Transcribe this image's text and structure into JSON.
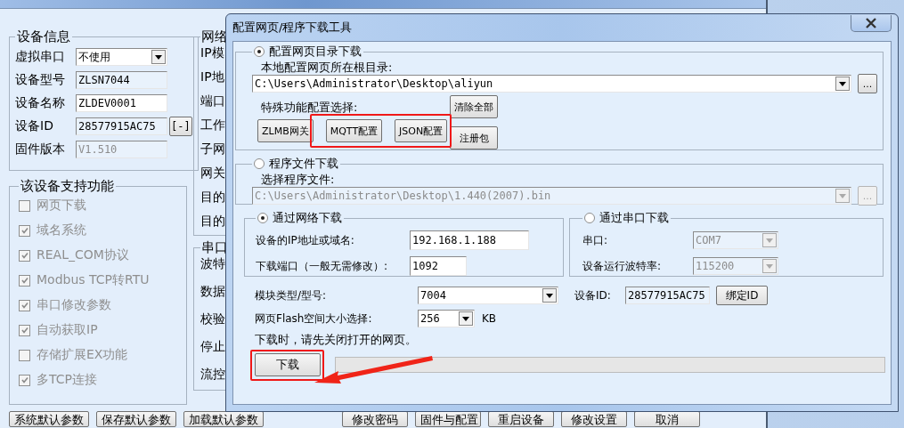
{
  "main_window": {
    "device_info": {
      "title": "设备信息",
      "fields": [
        {
          "kind": "select",
          "label": "虚拟串口",
          "value": "不使用"
        },
        {
          "kind": "readonly",
          "label": "设备型号",
          "value": "ZLSN7044"
        },
        {
          "kind": "text",
          "label": "设备名称",
          "value": "ZLDEV0001"
        },
        {
          "kind": "readonly_button",
          "label": "设备ID",
          "value": "28577915AC75",
          "button": "[-]"
        },
        {
          "kind": "disabled",
          "label": "固件版本",
          "value": "V1.510"
        }
      ]
    },
    "features": {
      "title": "该设备支持功能",
      "disabled": true,
      "items": [
        {
          "label": "网页下载",
          "checked": false
        },
        {
          "label": "域名系统",
          "checked": true
        },
        {
          "label": "REAL_COM协议",
          "checked": true
        },
        {
          "label": "Modbus TCP转RTU",
          "checked": true
        },
        {
          "label": "串口修改参数",
          "checked": true
        },
        {
          "label": "自动获取IP",
          "checked": true
        },
        {
          "label": "存储扩展EX功能",
          "checked": false
        },
        {
          "label": "多TCP连接",
          "checked": true
        }
      ]
    },
    "network": {
      "title": "网络",
      "labels": [
        "IP模",
        "IP地",
        "端口",
        "工作",
        "子网",
        "网关",
        "目的",
        "目的"
      ]
    },
    "serial": {
      "title": "串口",
      "labels": [
        "波特",
        "数据",
        "校验",
        "停止",
        "流控"
      ]
    },
    "buttons": [
      "系统默认参数",
      "保存默认参数",
      "加载默认参数",
      "修改密码",
      "固件与配置",
      "重启设备",
      "修改设置",
      "取消"
    ]
  },
  "dialog": {
    "title": "配置网页/程序下载工具",
    "web_dir": {
      "label": "配置网页目录下载",
      "selected": true,
      "path_label": "本地配置网页所在根目录:",
      "path": "C:\\Users\\Administrator\\Desktop\\aliyun",
      "browse": "...",
      "special_label": "特殊功能配置选择:",
      "clear_button": "清除全部",
      "buttons": [
        "ZLMB网关",
        "MQTT配置",
        "JSON配置",
        "注册包"
      ]
    },
    "program_file": {
      "label": "程序文件下载",
      "selected": false,
      "file_label": "选择程序文件:",
      "path": "C:\\Users\\Administrator\\Desktop\\1.440(2007).bin",
      "browse": "..."
    },
    "network": {
      "label": "通过网络下载",
      "selected": true,
      "ip_label": "设备的IP地址或域名:",
      "ip": "192.168.1.188",
      "port_label": "下载端口（一般无需修改）:",
      "port": "1092"
    },
    "serial": {
      "label": "通过串口下载",
      "selected": false,
      "port_label": "串口:",
      "port": "COM7",
      "baud_label": "设备运行波特率:",
      "baud": "115200"
    },
    "module_label": "模块类型/型号:",
    "module": "7004",
    "device_id_label": "设备ID:",
    "device_id": "28577915AC75",
    "bind_button": "绑定ID",
    "flash_label": "网页Flash空间大小选择:",
    "flash": "256",
    "flash_unit": "KB",
    "note": "下载时，请先关闭打开的网页。",
    "download_button": "下载",
    "progress": {
      "level": 0
    }
  },
  "annotations": [
    {
      "kind": "box"
    },
    {
      "kind": "box"
    },
    {
      "kind": "arrow"
    }
  ]
}
